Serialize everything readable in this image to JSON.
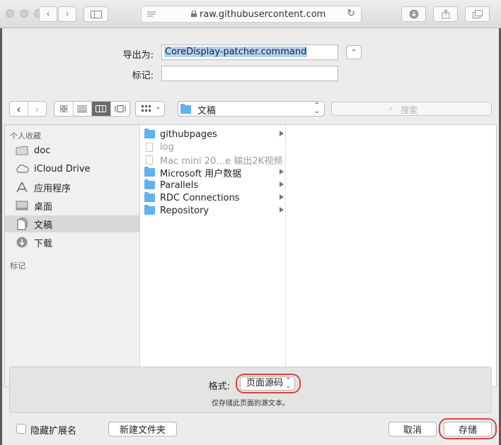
{
  "browser": {
    "url": "raw.githubusercontent.com"
  },
  "dialog": {
    "export_label": "导出为:",
    "filename": "CoreDisplay-patcher.command",
    "tags_label": "标记:",
    "tags_value": "",
    "location": "文稿",
    "search_placeholder": "搜索"
  },
  "sidebar": {
    "favorites_header": "个人收藏",
    "tags_header": "标记",
    "items": [
      {
        "label": "doc",
        "icon": "folder-icon"
      },
      {
        "label": "iCloud Drive",
        "icon": "cloud-icon"
      },
      {
        "label": "应用程序",
        "icon": "applications-icon"
      },
      {
        "label": "桌面",
        "icon": "desktop-icon"
      },
      {
        "label": "文稿",
        "icon": "documents-icon",
        "selected": true
      },
      {
        "label": "下载",
        "icon": "download-icon"
      }
    ]
  },
  "files": [
    {
      "name": "githubpages",
      "type": "folder",
      "has_children": true
    },
    {
      "name": "log",
      "type": "file",
      "dimmed": true
    },
    {
      "name": "Mac mini 20…e 输出2K视频",
      "type": "file",
      "dimmed": true
    },
    {
      "name": "Microsoft 用户数据",
      "type": "folder",
      "has_children": true
    },
    {
      "name": "Parallels",
      "type": "folder",
      "has_children": true
    },
    {
      "name": "RDC Connections",
      "type": "folder",
      "has_children": true
    },
    {
      "name": "Repository",
      "type": "folder",
      "has_children": true
    }
  ],
  "format": {
    "label": "格式:",
    "value": "页面源码",
    "hint": "仅存储此页面的源文本。"
  },
  "footer": {
    "hide_ext_label": "隐藏扩展名",
    "new_folder_label": "新建文件夹",
    "cancel_label": "取消",
    "save_label": "存储"
  },
  "colors": {
    "highlight_ring": "#d9453a",
    "folder": "#5fb2ee",
    "selection": "#b3d2f8"
  }
}
